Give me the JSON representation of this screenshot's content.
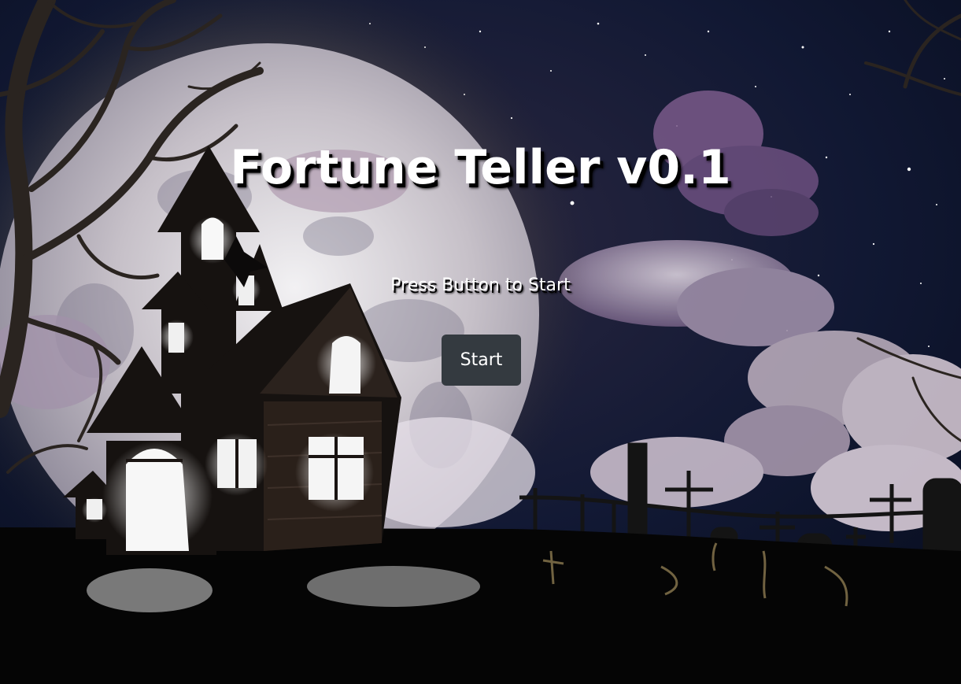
{
  "page": {
    "title": "Fortune Teller v0.1",
    "subtitle": "Press Button to Start",
    "start_label": "Start"
  },
  "background": {
    "description_icon": "haunted-house-night-scene",
    "colors": {
      "sky_top": "#050a18",
      "sky_mid": "#141a35",
      "moon": "#c9c4c6",
      "cloud": "#8e7f9a",
      "ground": "#050505",
      "window_glow": "#ffffff",
      "button": "#343a40"
    }
  }
}
